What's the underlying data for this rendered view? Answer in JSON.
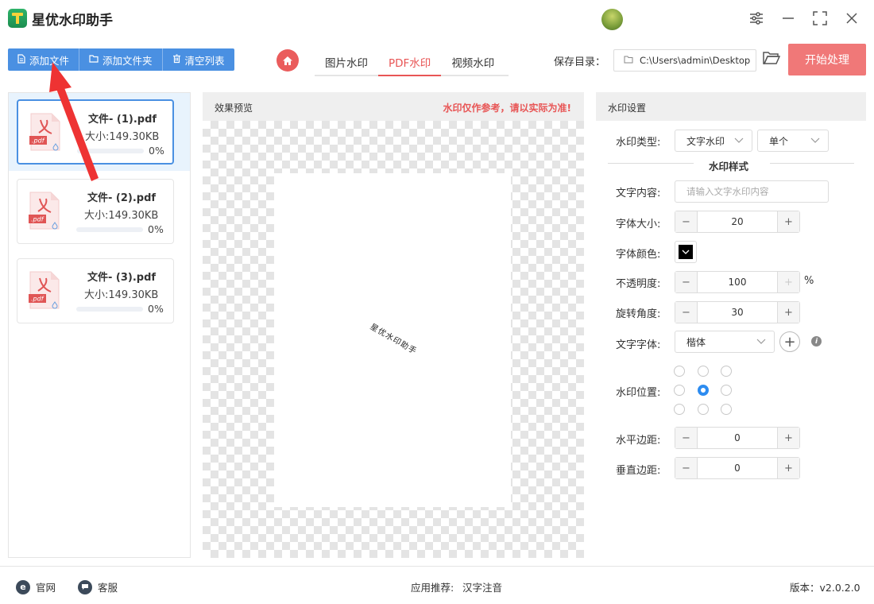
{
  "app": {
    "title": "星优水印助手"
  },
  "window_controls": {
    "settings_icon": "sliders-icon",
    "minimize_icon": "minimize-icon",
    "maximize_icon": "maximize-icon",
    "close_icon": "close-icon"
  },
  "toolbar": {
    "add_file": "添加文件",
    "add_folder": "添加文件夹",
    "clear_list": "清空列表"
  },
  "tabs": [
    {
      "label": "图片水印",
      "active": false
    },
    {
      "label": "PDF水印",
      "active": true
    },
    {
      "label": "视频水印",
      "active": false
    }
  ],
  "save": {
    "label": "保存目录：",
    "path": "C:\\Users\\admin\\Desktop"
  },
  "start_button": "开始处理",
  "files": [
    {
      "name": "文件- (1).pdf",
      "size": "大小:149.30KB",
      "percent": "0%",
      "progress": 0,
      "selected": true
    },
    {
      "name": "文件- (2).pdf",
      "size": "大小:149.30KB",
      "percent": "0%",
      "progress": 0,
      "selected": false
    },
    {
      "name": "文件- (3).pdf",
      "size": "大小:149.30KB",
      "percent": "0%",
      "progress": 0,
      "selected": false
    }
  ],
  "preview": {
    "title": "效果预览",
    "note": "水印仅作参考，请以实际为准!",
    "watermark_text": "星优水印助手"
  },
  "settings": {
    "title": "水印设置",
    "type_label": "水印类型:",
    "type_value": "文字水印",
    "mode_value": "单个",
    "style_section": "水印样式",
    "text_label": "文字内容:",
    "text_placeholder": "请输入文字水印内容",
    "font_size_label": "字体大小:",
    "font_size": "20",
    "font_color_label": "字体颜色:",
    "font_color": "#000000",
    "opacity_label": "不透明度:",
    "opacity": "100",
    "opacity_unit": "%",
    "rotation_label": "旋转角度:",
    "rotation": "30",
    "font_family_label": "文字字体:",
    "font_family": "楷体",
    "position_label": "水印位置:",
    "position_selected": "center",
    "h_margin_label": "水平边距:",
    "h_margin": "0",
    "v_margin_label": "垂直边距:",
    "v_margin": "0"
  },
  "footer": {
    "website": "官网",
    "support": "客服",
    "recommend_label": "应用推荐:",
    "recommend_app": "汉字注音",
    "version": "版本：v2.0.2.0"
  },
  "colors": {
    "accent_blue": "#4a90e2",
    "accent_red": "#e85555",
    "start_button": "#f07878"
  }
}
